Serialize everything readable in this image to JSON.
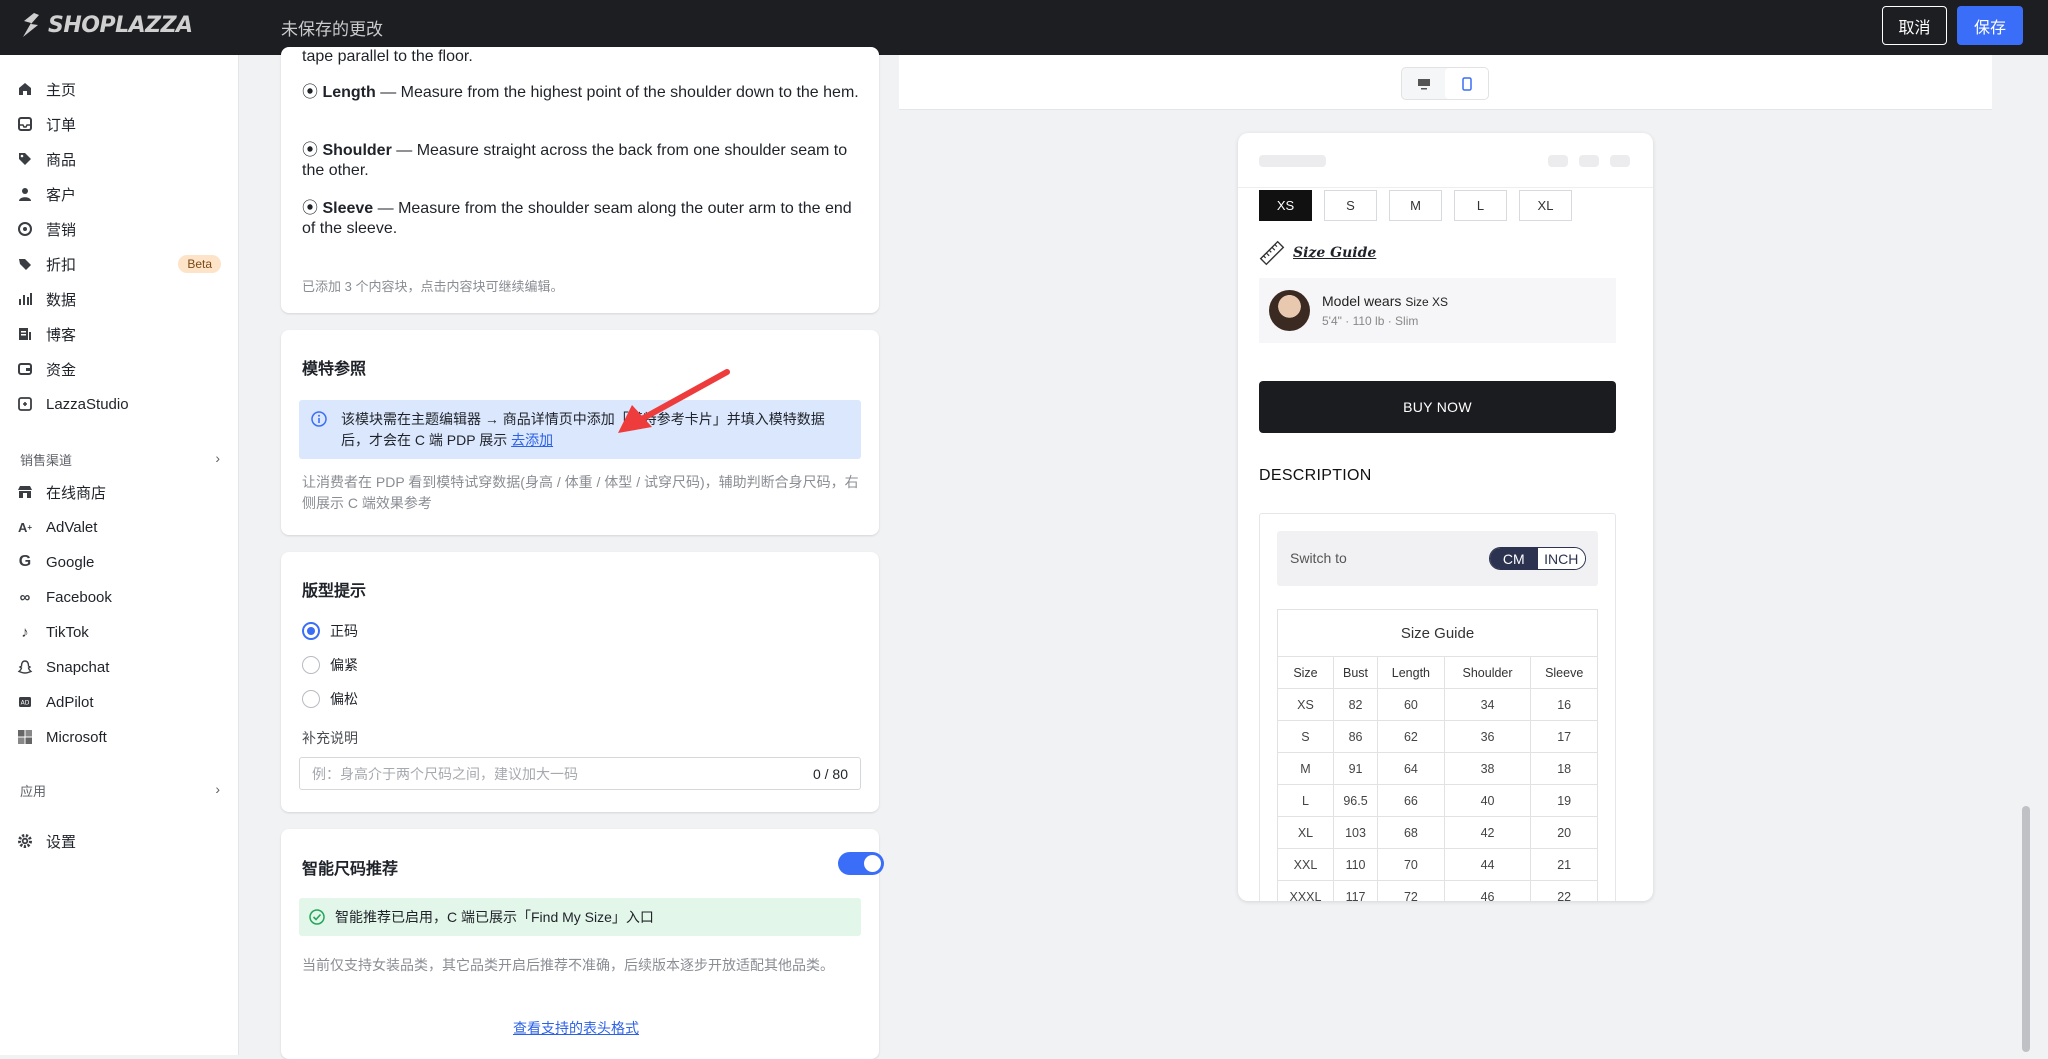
{
  "topbar": {
    "brand": "SHOPLAZZA",
    "unsaved": "未保存的更改",
    "cancel": "取消",
    "save": "保存"
  },
  "sidebar": {
    "items": [
      {
        "label": "主页",
        "icon": "home-icon"
      },
      {
        "label": "订单",
        "icon": "inbox-icon"
      },
      {
        "label": "商品",
        "icon": "tag-icon"
      },
      {
        "label": "客户",
        "icon": "user-icon"
      },
      {
        "label": "营销",
        "icon": "target-icon"
      },
      {
        "label": "折扣",
        "icon": "discount-icon",
        "badge": "Beta"
      },
      {
        "label": "数据",
        "icon": "bar-chart-icon"
      },
      {
        "label": "博客",
        "icon": "blog-icon"
      },
      {
        "label": "资金",
        "icon": "wallet-icon"
      },
      {
        "label": "LazzaStudio",
        "icon": "studio-icon"
      }
    ],
    "channels_title": "销售渠道",
    "channels": [
      {
        "label": "在线商店",
        "icon": "store-icon"
      },
      {
        "label": "AdValet",
        "icon": "advalet-icon"
      },
      {
        "label": "Google",
        "icon": "google-icon"
      },
      {
        "label": "Facebook",
        "icon": "meta-icon"
      },
      {
        "label": "TikTok",
        "icon": "tiktok-icon"
      },
      {
        "label": "Snapchat",
        "icon": "snapchat-icon"
      },
      {
        "label": "AdPilot",
        "icon": "adpilot-icon"
      },
      {
        "label": "Microsoft",
        "icon": "microsoft-icon"
      }
    ],
    "apps_title": "应用",
    "settings": "设置"
  },
  "measure_card": {
    "partial_line": "tape parallel to the floor.",
    "items": [
      {
        "term": "Length",
        "text": " — Measure from the highest point of the shoulder down to the hem."
      },
      {
        "term": "Shoulder",
        "text": " — Measure straight across the back from one shoulder seam to the other."
      },
      {
        "term": "Sleeve",
        "text": " — Measure from the shoulder seam along the outer arm to the end of the sleeve."
      }
    ],
    "footer": "已添加 3 个内容块，点击内容块可继续编辑。"
  },
  "model_card": {
    "title": "模特参照",
    "info_text": "该模块需在主题编辑器 → 商品详情页中添加「模特参考卡片」并填入模特数据后，才会在 C 端 PDP 展示",
    "info_link": "去添加",
    "desc": "让消费者在 PDP 看到模特试穿数据(身高 / 体重 / 体型 / 试穿尺码)，辅助判断合身尺码，右侧展示 C 端效果参考"
  },
  "fit_card": {
    "title": "版型提示",
    "options": [
      "正码",
      "偏紧",
      "偏松"
    ],
    "selected": "正码",
    "note_label": "补充说明",
    "note_placeholder": "例：身高介于两个尺码之间，建议加大一码",
    "note_count": "0 / 80"
  },
  "smart_card": {
    "title": "智能尺码推荐",
    "enabled": true,
    "success": "智能推荐已启用，C 端已展示「Find My Size」入口",
    "note": "当前仅支持女装品类，其它品类开启后推荐不准确，后续版本逐步开放适配其他品类。",
    "link": "查看支持的表头格式"
  },
  "preview": {
    "sizes": [
      "XS",
      "S",
      "M",
      "L",
      "XL"
    ],
    "selected_size": "XS",
    "size_guide_link": "Size Guide",
    "model_wears": "Model wears",
    "model_size": "Size XS",
    "model_stats": "5'4\" · 110 lb · Slim",
    "buy_now": "BUY NOW",
    "description": "DESCRIPTION",
    "switch_to": "Switch to",
    "unit_on": "CM",
    "unit_off": "INCH",
    "table_title": "Size Guide",
    "headers": [
      "Size",
      "Bust",
      "Length",
      "Shoulder",
      "Sleeve"
    ],
    "rows": [
      [
        "XS",
        "82",
        "60",
        "34",
        "16"
      ],
      [
        "S",
        "86",
        "62",
        "36",
        "17"
      ],
      [
        "M",
        "91",
        "64",
        "38",
        "18"
      ],
      [
        "L",
        "96.5",
        "66",
        "40",
        "19"
      ],
      [
        "XL",
        "103",
        "68",
        "42",
        "20"
      ],
      [
        "XXL",
        "110",
        "70",
        "44",
        "21"
      ],
      [
        "XXXL",
        "117",
        "72",
        "46",
        "22"
      ]
    ]
  },
  "colors": {
    "accent": "#3b6ef8",
    "topbar": "#1d1e21",
    "arrow": "#ee3b3b",
    "info_bg": "#dbe7fd",
    "success_bg": "#e3f6ea"
  }
}
